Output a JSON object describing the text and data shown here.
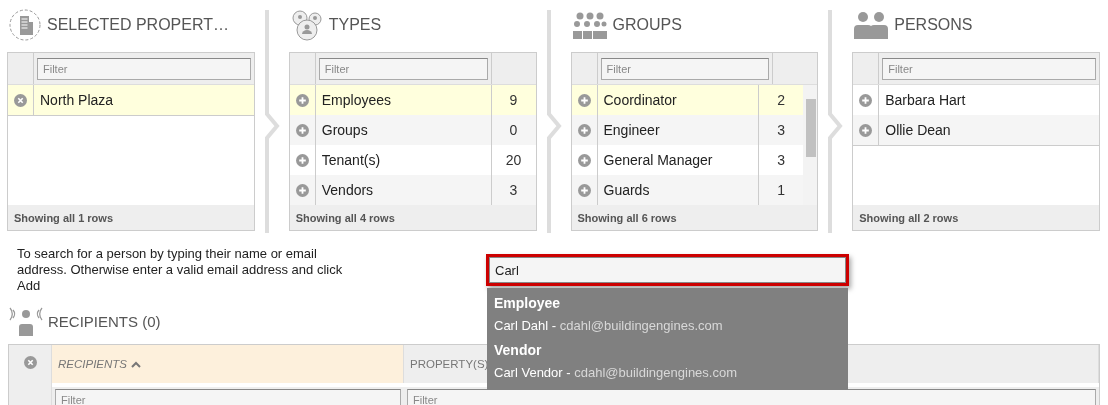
{
  "panels": [
    {
      "title": "SELECTED PROPERT…",
      "filter": {
        "placeholder": "Filter"
      },
      "rows": [
        {
          "name": "North Plaza",
          "kind": "remove",
          "selected": true
        }
      ],
      "footer": "Showing all 1 rows"
    },
    {
      "title": "TYPES",
      "filter": {
        "placeholder": "Filter"
      },
      "rows": [
        {
          "name": "Employees",
          "count": "9",
          "kind": "add",
          "selected": true
        },
        {
          "name": "Groups",
          "count": "0",
          "kind": "add",
          "selected": false
        },
        {
          "name": "Tenant(s)",
          "count": "20",
          "kind": "add",
          "selected": false
        },
        {
          "name": "Vendors",
          "count": "3",
          "kind": "add",
          "selected": false
        }
      ],
      "footer": "Showing all 4 rows"
    },
    {
      "title": "GROUPS",
      "filter": {
        "placeholder": "Filter"
      },
      "rows": [
        {
          "name": "Coordinator",
          "count": "2",
          "kind": "add",
          "selected": true
        },
        {
          "name": "Engineer",
          "count": "3",
          "kind": "add",
          "selected": false
        },
        {
          "name": "General Manager",
          "count": "3",
          "kind": "add",
          "selected": false
        },
        {
          "name": "Guards",
          "count": "1",
          "kind": "add",
          "selected": false
        }
      ],
      "footer": "Showing all 6 rows"
    },
    {
      "title": "PERSONS",
      "filter": {
        "placeholder": "Filter"
      },
      "rows": [
        {
          "name": "Barbara Hart",
          "kind": "add",
          "selected": false
        },
        {
          "name": "Ollie Dean",
          "kind": "add",
          "selected": false
        }
      ],
      "footer": "Showing all 2 rows"
    }
  ],
  "instructions": "To search for a person by typing their name or email address. Otherwise enter a valid email address and click Add",
  "search": {
    "value": "Carl",
    "suggestions": [
      {
        "heading": "Employee",
        "items": [
          {
            "label": "Carl Dahl -",
            "email": "cdahl@buildingengines.com"
          }
        ]
      },
      {
        "heading": "Vendor",
        "items": [
          {
            "label": "Carl Vendor -",
            "email": "cdahl@buildingengines.com"
          }
        ]
      }
    ]
  },
  "recipients": {
    "title": "RECIPIENTS (0)",
    "columns": [
      {
        "label": "RECIPIENTS",
        "sorted": true,
        "filter": {
          "placeholder": "Filter"
        }
      },
      {
        "label": "PROPERTY(S)",
        "sorted": false,
        "filter": {
          "placeholder": "Filter"
        }
      }
    ]
  }
}
